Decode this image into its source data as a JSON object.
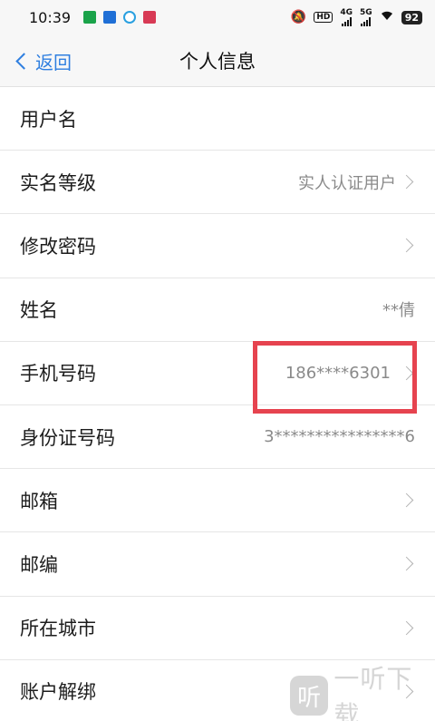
{
  "status_bar": {
    "time": "10:39",
    "network_a": "4G",
    "network_b": "5G",
    "battery": "92",
    "hd": "HD"
  },
  "nav": {
    "back_label": "返回",
    "title": "个人信息"
  },
  "rows": [
    {
      "label": "用户名",
      "value": ""
    },
    {
      "label": "实名等级",
      "value": "实人认证用户"
    },
    {
      "label": "修改密码",
      "value": ""
    },
    {
      "label": "姓名",
      "value": "**倩"
    },
    {
      "label": "手机号码",
      "value": "186****6301"
    },
    {
      "label": "身份证号码",
      "value": "3****************6"
    },
    {
      "label": "邮箱",
      "value": ""
    },
    {
      "label": "邮编",
      "value": ""
    },
    {
      "label": "所在城市",
      "value": ""
    },
    {
      "label": "账户解绑",
      "value": ""
    }
  ],
  "watermark": {
    "logo": "听",
    "text": "一听下载"
  },
  "colors": {
    "accent": "#2f7fe0",
    "highlight": "#e6434f"
  }
}
